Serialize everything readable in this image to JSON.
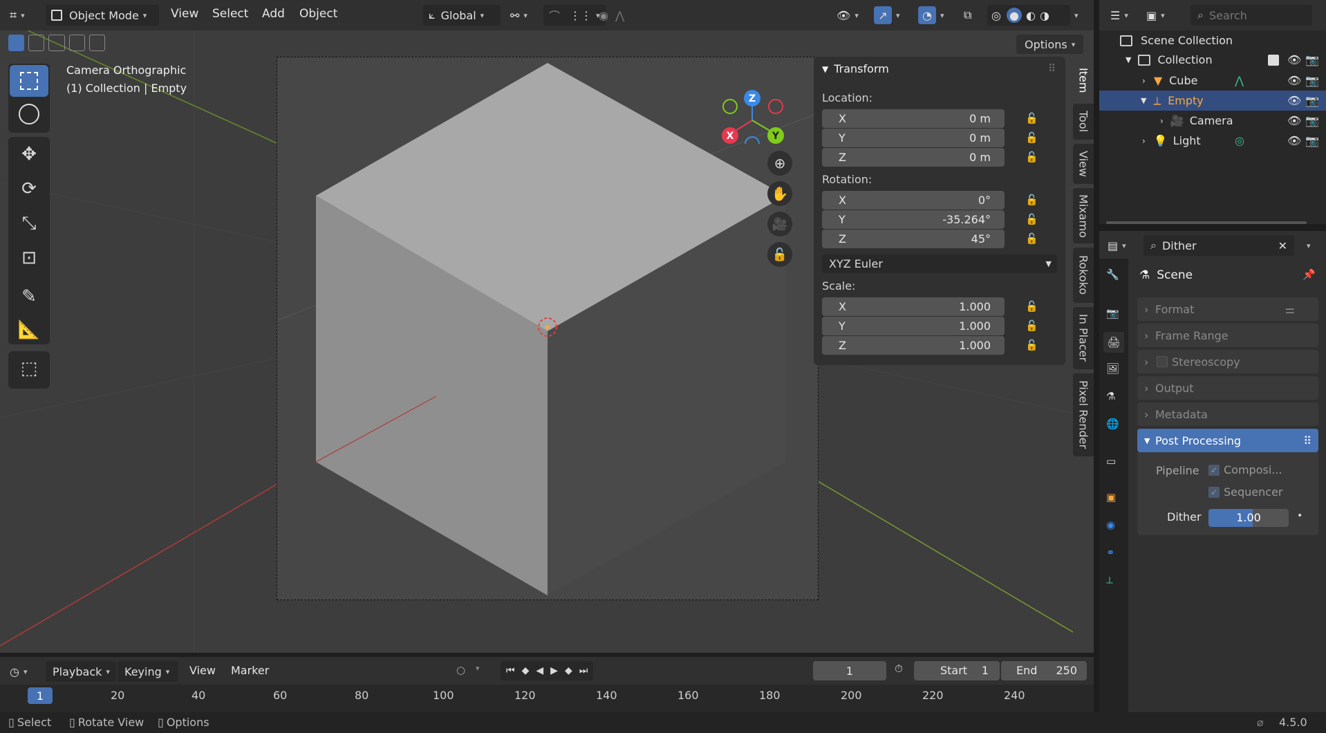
{
  "header": {
    "mode": "Object Mode",
    "menus": [
      "View",
      "Select",
      "Add",
      "Object"
    ],
    "orientation": "Global",
    "options_label": "Options"
  },
  "viewport": {
    "camera_label": "Camera Orthographic",
    "collection_label": "(1) Collection | Empty",
    "gizmo": {
      "x": "X",
      "y": "Y",
      "z": "Z"
    }
  },
  "npanel": {
    "title": "Transform",
    "location_label": "Location:",
    "location": [
      {
        "axis": "X",
        "value": "0 m"
      },
      {
        "axis": "Y",
        "value": "0 m"
      },
      {
        "axis": "Z",
        "value": "0 m"
      }
    ],
    "rotation_label": "Rotation:",
    "rotation": [
      {
        "axis": "X",
        "value": "0°"
      },
      {
        "axis": "Y",
        "value": "-35.264°"
      },
      {
        "axis": "Z",
        "value": "45°"
      }
    ],
    "rotation_mode": "XYZ Euler",
    "scale_label": "Scale:",
    "scale": [
      {
        "axis": "X",
        "value": "1.000"
      },
      {
        "axis": "Y",
        "value": "1.000"
      },
      {
        "axis": "Z",
        "value": "1.000"
      }
    ],
    "tabs": [
      "Item",
      "Tool",
      "View",
      "Mixamo",
      "Rokoko",
      "In Placer",
      "Pixel Render"
    ]
  },
  "outliner": {
    "search_placeholder": "Search",
    "scene_collection": "Scene Collection",
    "items": [
      {
        "label": "Collection"
      },
      {
        "label": "Cube"
      },
      {
        "label": "Empty"
      },
      {
        "label": "Camera"
      },
      {
        "label": "Light"
      }
    ]
  },
  "properties": {
    "search_value": "Dither",
    "context": "Scene",
    "panels": [
      "Format",
      "Frame Range",
      "Stereoscopy",
      "Output",
      "Metadata",
      "Post Processing"
    ],
    "pipeline_label": "Pipeline",
    "compositing": "Composi...",
    "sequencer": "Sequencer",
    "dither_label": "Dither",
    "dither_value": "1.00"
  },
  "timeline": {
    "menus": [
      "Playback",
      "Keying",
      "View",
      "Marker"
    ],
    "current_frame": "1",
    "start_label": "Start",
    "start_value": "1",
    "end_label": "End",
    "end_value": "250",
    "ticks": [
      "1",
      "20",
      "40",
      "60",
      "80",
      "100",
      "120",
      "140",
      "160",
      "180",
      "200",
      "220",
      "240"
    ]
  },
  "status": {
    "items": [
      "Select",
      "Rotate View",
      "Options"
    ],
    "version": "4.5.0"
  },
  "colors": {
    "accent": "#4772b3",
    "axis_x": "#e8384f",
    "axis_y": "#7fcc1a",
    "axis_z": "#3a8ae6",
    "selected_text": "#f5a742"
  }
}
